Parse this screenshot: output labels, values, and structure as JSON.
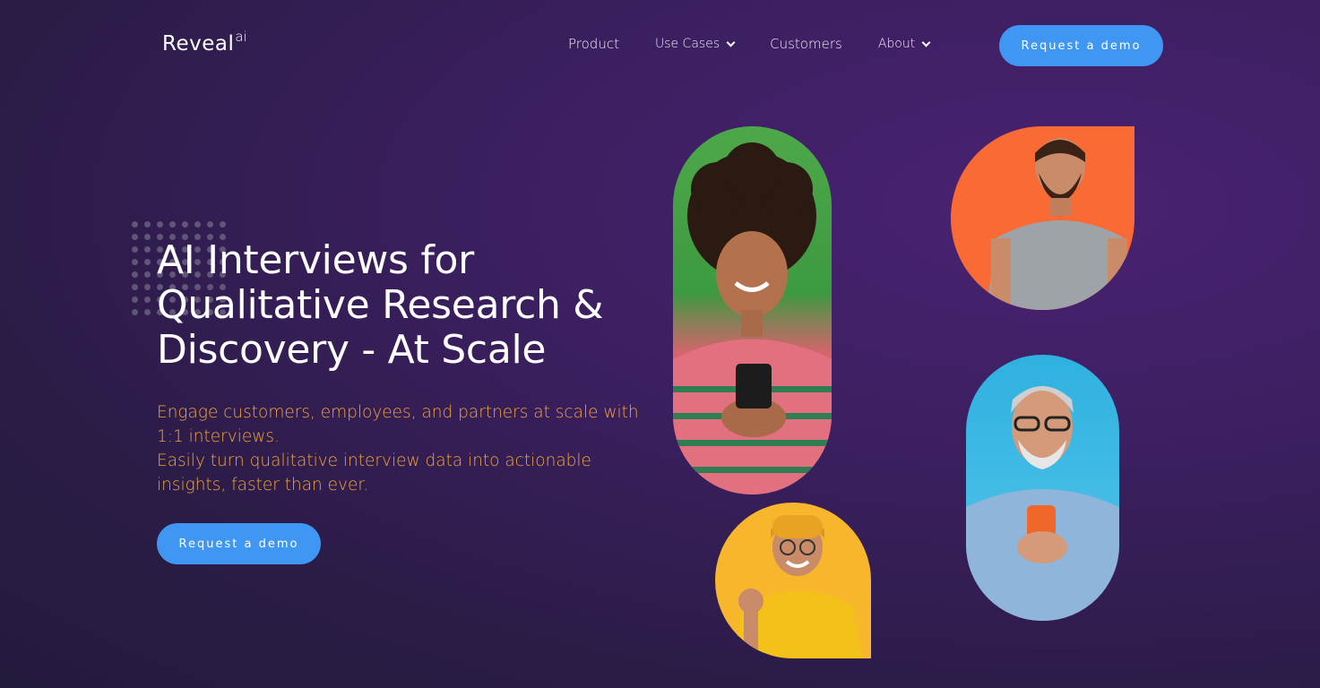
{
  "brand": {
    "name": "Reveal",
    "superscript": "ai"
  },
  "nav": {
    "items": [
      {
        "label": "Product",
        "has_dropdown": false
      },
      {
        "label": "Use Cases",
        "has_dropdown": true
      },
      {
        "label": "Customers",
        "has_dropdown": false
      },
      {
        "label": "About",
        "has_dropdown": true
      }
    ],
    "cta_label": "Request a demo"
  },
  "hero": {
    "headline_lines": [
      "AI Interviews for",
      "Qualitative Research &",
      "Discovery - At Scale"
    ],
    "subtext_line_1": "Engage customers, employees, and partners at scale with 1:1 interviews.",
    "subtext_line_2": "Easily turn qualitative interview data into actionable insights, faster than ever.",
    "cta_label": "Request a demo"
  },
  "photos": [
    {
      "name": "woman-with-phone-photo",
      "background": "#4ea84a"
    },
    {
      "name": "bearded-man-photo",
      "background": "#fa6a34"
    },
    {
      "name": "man-yellow-beanie-photo",
      "background": "#f7b62b"
    },
    {
      "name": "older-man-with-phone-photo",
      "background": "#2fb1e0"
    }
  ],
  "colors": {
    "accent": "#3f96f3",
    "subtext": "#f2a43a",
    "background": "#3a1f5e"
  }
}
